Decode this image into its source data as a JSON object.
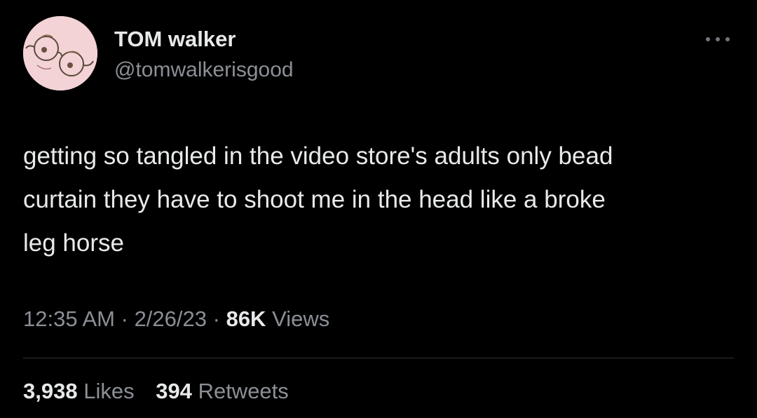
{
  "author": {
    "display_name": "TOM walker",
    "handle": "@tomwalkerisgood",
    "avatar_icon": "glasses-avatar-icon"
  },
  "more_icon": "ellipsis-icon",
  "tweet": {
    "text": "getting so tangled in the video store's adults only bead\ncurtain they have to shoot me in the head like a broke\nleg horse"
  },
  "meta": {
    "time": "12:35 AM",
    "separator": "·",
    "date": "2/26/23",
    "views_count": "86K",
    "views_label": "Views"
  },
  "stats": {
    "likes_count": "3,938",
    "likes_label": "Likes",
    "retweets_count": "394",
    "retweets_label": "Retweets"
  },
  "colors": {
    "background": "#000000",
    "primary_text": "#e7e9ea",
    "secondary_text": "#8b9096",
    "avatar_bg": "#f4d2d4"
  }
}
